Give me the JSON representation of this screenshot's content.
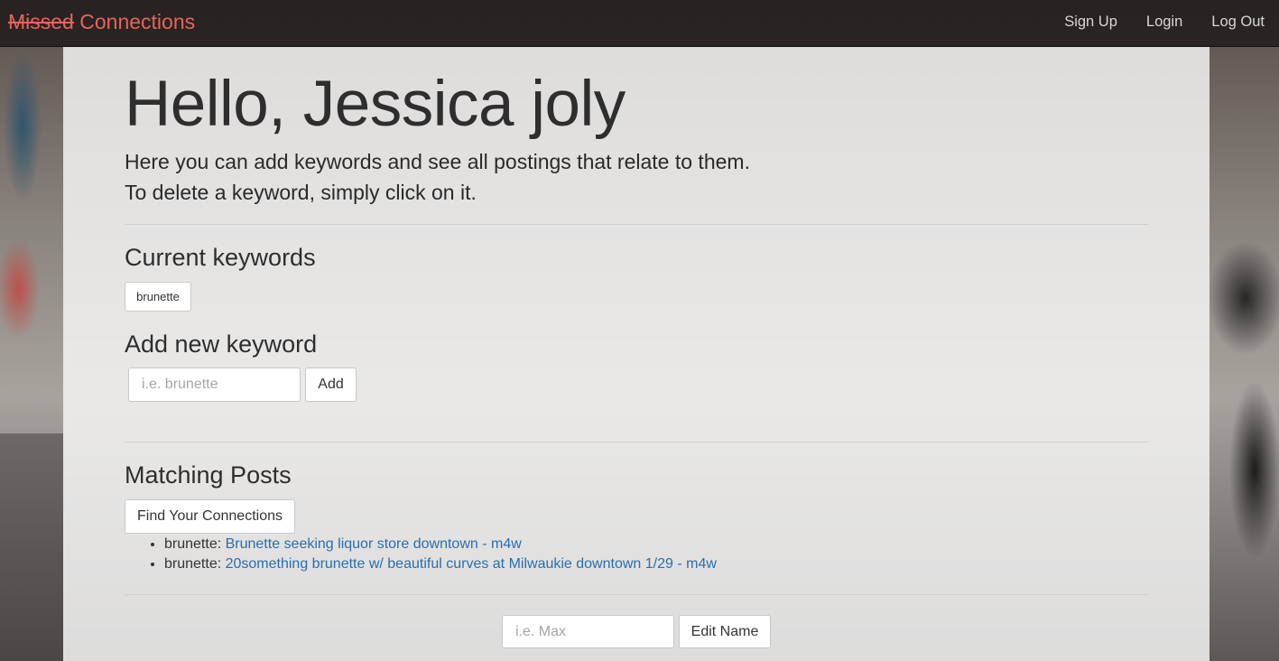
{
  "navbar": {
    "brand_struck": "Missed",
    "brand_rest": " Connections",
    "links": [
      "Sign Up",
      "Login",
      "Log Out"
    ]
  },
  "hero": {
    "title": "Hello, Jessica joly",
    "lead_line1": "Here you can add keywords and see all postings that relate to them.",
    "lead_line2": "To delete a keyword, simply click on it."
  },
  "keywords": {
    "heading": "Current keywords",
    "items": [
      "brunette"
    ]
  },
  "add_keyword": {
    "heading": "Add new keyword",
    "placeholder": "i.e. brunette",
    "button_label": "Add"
  },
  "matches": {
    "heading": "Matching Posts",
    "find_button_label": "Find Your Connections",
    "posts": [
      {
        "keyword": "brunette:",
        "title": "Brunette seeking liquor store downtown - m4w"
      },
      {
        "keyword": "brunette:",
        "title": "20something brunette w/ beautiful curves at Milwaukie downtown 1/29 - m4w"
      }
    ]
  },
  "edit_name": {
    "placeholder": "i.e. Max",
    "button_label": "Edit Name"
  },
  "colors": {
    "brand": "#e8645a",
    "link": "#2a6ead"
  }
}
